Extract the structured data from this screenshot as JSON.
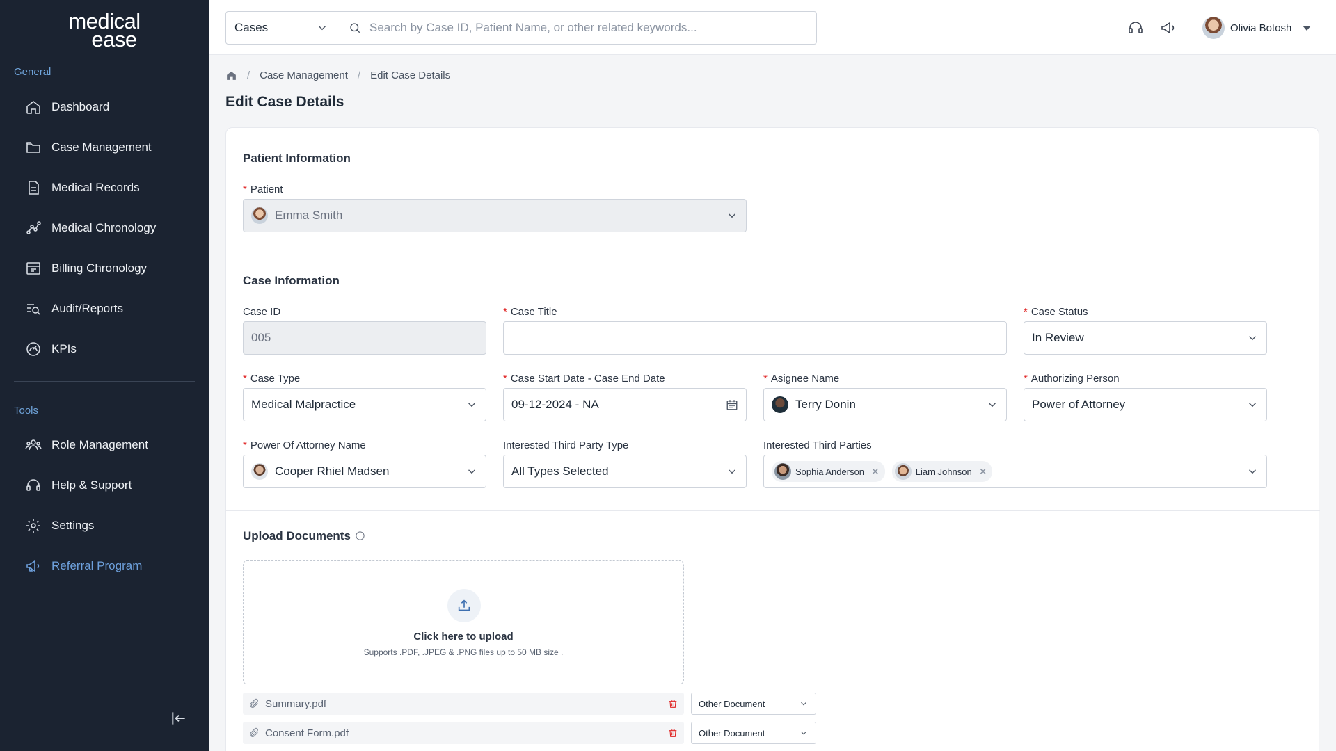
{
  "brand": {
    "line1": "medical",
    "line2": "ease"
  },
  "sidebar": {
    "general_label": "General",
    "tools_label": "Tools",
    "general_items": [
      {
        "label": "Dashboard",
        "icon": "home-icon"
      },
      {
        "label": "Case Management",
        "icon": "folder-icon"
      },
      {
        "label": "Medical Records",
        "icon": "document-icon"
      },
      {
        "label": "Medical Chronology",
        "icon": "chart-line-icon"
      },
      {
        "label": "Billing Chronology",
        "icon": "billing-icon"
      },
      {
        "label": "Audit/Reports",
        "icon": "report-search-icon"
      },
      {
        "label": "KPIs",
        "icon": "gauge-icon"
      }
    ],
    "tool_items": [
      {
        "label": "Role Management",
        "icon": "users-icon"
      },
      {
        "label": "Help & Support",
        "icon": "headset-icon"
      },
      {
        "label": "Settings",
        "icon": "gear-icon"
      },
      {
        "label": "Referral Program",
        "icon": "megaphone-icon"
      }
    ],
    "active_item": "Referral Program",
    "active_color": "#6ea0dc"
  },
  "topbar": {
    "scope_value": "Cases",
    "search_placeholder": "Search by Case ID, Patient Name, or other related keywords...",
    "user_name": "Olivia Botosh"
  },
  "breadcrumb": {
    "items": [
      "Case Management",
      "Edit Case Details"
    ]
  },
  "page": {
    "title": "Edit Case Details"
  },
  "patient_section": {
    "title": "Patient Information",
    "patient_label": "Patient",
    "patient_value": "Emma Smith"
  },
  "case_section": {
    "title": "Case Information",
    "case_id_label": "Case ID",
    "case_id_value": "005",
    "case_title_label": "Case Title",
    "case_title_value": "",
    "case_status_label": "Case Status",
    "case_status_value": "In Review",
    "case_type_label": "Case Type",
    "case_type_value": "Medical Malpractice",
    "dates_label": "Case Start Date - Case End Date",
    "dates_value": "09-12-2024 - NA",
    "assignee_label": "Asignee Name",
    "assignee_value": "Terry Donin",
    "authorizing_label": "Authorizing Person",
    "authorizing_value": "Power of Attorney",
    "poa_label": "Power Of Attorney Name",
    "poa_value": "Cooper Rhiel Madsen",
    "third_type_label": "Interested Third Party Type",
    "third_type_value": "All Types Selected",
    "third_parties_label": "Interested Third Parties",
    "third_parties": [
      "Sophia Anderson",
      "Liam Johnson"
    ]
  },
  "upload_section": {
    "title": "Upload Documents",
    "dropzone_title": "Click here to upload",
    "dropzone_sub": "Supports .PDF, .JPEG & .PNG files up to 50 MB size .",
    "files": [
      {
        "name": "Summary.pdf",
        "type": "Other Document"
      },
      {
        "name": "Consent Form.pdf",
        "type": "Other Document"
      }
    ]
  },
  "colors": {
    "sidebar_bg": "#1b2331",
    "required": "#e02424",
    "delete": "#e02424"
  }
}
